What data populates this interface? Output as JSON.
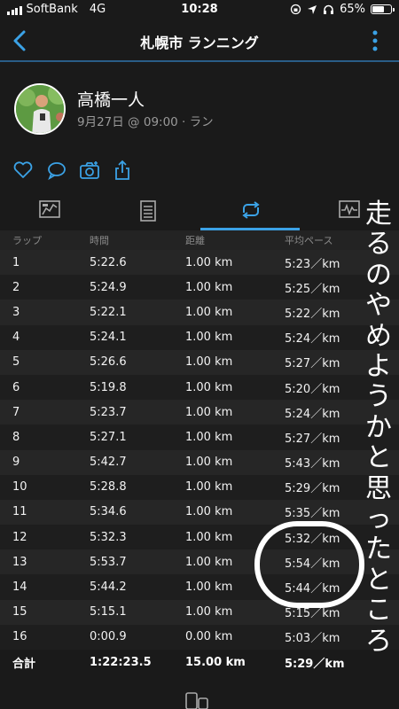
{
  "status_bar": {
    "carrier": "SoftBank",
    "network": "4G",
    "time": "10:28",
    "battery": "65%"
  },
  "nav": {
    "title": "札幌市 ランニング"
  },
  "activity": {
    "user_name": "高橋一人",
    "meta": "9月27日 @ 09:00 · ラン"
  },
  "actions": [
    "heart-icon",
    "comment-icon",
    "camera-icon",
    "share-icon"
  ],
  "tabs": [
    {
      "icon": "overview-icon",
      "active": false
    },
    {
      "icon": "details-icon",
      "active": false
    },
    {
      "icon": "laps-icon",
      "active": true
    },
    {
      "icon": "charts-icon",
      "active": false
    }
  ],
  "laps": {
    "headers": [
      "ラップ",
      "時間",
      "距離",
      "平均ペース"
    ],
    "rows": [
      [
        "1",
        "5:22.6",
        "1.00 km",
        "5:23／km"
      ],
      [
        "2",
        "5:24.9",
        "1.00 km",
        "5:25／km"
      ],
      [
        "3",
        "5:22.1",
        "1.00 km",
        "5:22／km"
      ],
      [
        "4",
        "5:24.1",
        "1.00 km",
        "5:24／km"
      ],
      [
        "5",
        "5:26.6",
        "1.00 km",
        "5:27／km"
      ],
      [
        "6",
        "5:19.8",
        "1.00 km",
        "5:20／km"
      ],
      [
        "7",
        "5:23.7",
        "1.00 km",
        "5:24／km"
      ],
      [
        "8",
        "5:27.1",
        "1.00 km",
        "5:27／km"
      ],
      [
        "9",
        "5:42.7",
        "1.00 km",
        "5:43／km"
      ],
      [
        "10",
        "5:28.8",
        "1.00 km",
        "5:29／km"
      ],
      [
        "11",
        "5:34.6",
        "1.00 km",
        "5:35／km"
      ],
      [
        "12",
        "5:32.3",
        "1.00 km",
        "5:32／km"
      ],
      [
        "13",
        "5:53.7",
        "1.00 km",
        "5:54／km"
      ],
      [
        "14",
        "5:44.2",
        "1.00 km",
        "5:44／km"
      ],
      [
        "15",
        "5:15.1",
        "1.00 km",
        "5:15／km"
      ],
      [
        "16",
        "0:00.9",
        "0.00 km",
        "5:03／km"
      ]
    ],
    "total": [
      "合計",
      "1:22:23.5",
      "15.00 km",
      "5:29／km"
    ]
  },
  "overlay_text": "走るのやめようかと思ったところ",
  "colors": {
    "accent": "#3ba2e6",
    "background": "#1a1a1a",
    "nav_border": "#2a5d87"
  }
}
